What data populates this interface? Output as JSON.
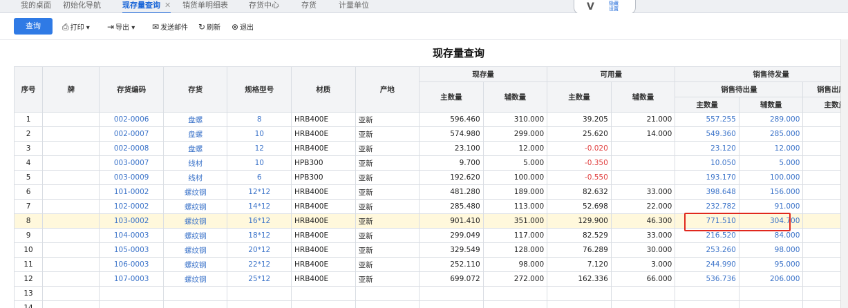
{
  "tabs": [
    {
      "label": "我的桌面",
      "active": false
    },
    {
      "label": "初始化导航",
      "active": false
    },
    {
      "label": "现存量查询",
      "active": true,
      "close": "✕"
    },
    {
      "label": "销货单明细表",
      "active": false
    },
    {
      "label": "存货中心",
      "active": false
    },
    {
      "label": "存货",
      "active": false
    },
    {
      "label": "计量单位",
      "active": false
    }
  ],
  "logo": {
    "mark": "V",
    "text": "隐藏设置"
  },
  "toolbar": {
    "query": "查询",
    "print": "打印",
    "export": "导出",
    "email": "发送邮件",
    "refresh": "刷新",
    "exit": "退出"
  },
  "page_title": "现存量查询",
  "table": {
    "headers": {
      "seq": "序号",
      "brand": "牌",
      "code": "存货编码",
      "item": "存货",
      "spec": "规格型号",
      "material": "材质",
      "origin": "产地",
      "onhand": "现存量",
      "available": "可用量",
      "sales_pending": "销售待发量",
      "sales_out_pending": "销售待出量",
      "sales_out_entry": "销售出库单",
      "main_qty": "主数量",
      "aux_qty": "辅数量"
    },
    "rows": [
      {
        "seq": "1",
        "code": "002-0006",
        "item": "盘螺",
        "spec": "8",
        "material": "HRB400E",
        "origin": "亚新",
        "oh_main": "596.460",
        "oh_aux": "310.000",
        "av_main": "39.205",
        "av_aux": "21.000",
        "so_main": "557.255",
        "so_aux": "289.000",
        "se_main": ""
      },
      {
        "seq": "2",
        "code": "002-0007",
        "item": "盘螺",
        "spec": "10",
        "material": "HRB400E",
        "origin": "亚新",
        "oh_main": "574.980",
        "oh_aux": "299.000",
        "av_main": "25.620",
        "av_aux": "14.000",
        "so_main": "549.360",
        "so_aux": "285.000",
        "se_main": ""
      },
      {
        "seq": "3",
        "code": "002-0008",
        "item": "盘螺",
        "spec": "12",
        "material": "HRB400E",
        "origin": "亚新",
        "oh_main": "23.100",
        "oh_aux": "12.000",
        "av_main": "-0.020",
        "av_aux": "",
        "so_main": "23.120",
        "so_aux": "12.000",
        "se_main": ""
      },
      {
        "seq": "4",
        "code": "003-0007",
        "item": "线材",
        "spec": "10",
        "material": "HPB300",
        "origin": "亚新",
        "oh_main": "9.700",
        "oh_aux": "5.000",
        "av_main": "-0.350",
        "av_aux": "",
        "so_main": "10.050",
        "so_aux": "5.000",
        "se_main": ""
      },
      {
        "seq": "5",
        "code": "003-0009",
        "item": "线材",
        "spec": "6",
        "material": "HPB300",
        "origin": "亚新",
        "oh_main": "192.620",
        "oh_aux": "100.000",
        "av_main": "-0.550",
        "av_aux": "",
        "so_main": "193.170",
        "so_aux": "100.000",
        "se_main": ""
      },
      {
        "seq": "6",
        "code": "101-0002",
        "item": "螺纹钢",
        "spec": "12*12",
        "material": "HRB400E",
        "origin": "亚新",
        "oh_main": "481.280",
        "oh_aux": "189.000",
        "av_main": "82.632",
        "av_aux": "33.000",
        "so_main": "398.648",
        "so_aux": "156.000",
        "se_main": ""
      },
      {
        "seq": "7",
        "code": "102-0002",
        "item": "螺纹钢",
        "spec": "14*12",
        "material": "HRB400E",
        "origin": "亚新",
        "oh_main": "285.480",
        "oh_aux": "113.000",
        "av_main": "52.698",
        "av_aux": "22.000",
        "so_main": "232.782",
        "so_aux": "91.000",
        "se_main": ""
      },
      {
        "seq": "8",
        "code": "103-0002",
        "item": "螺纹钢",
        "spec": "16*12",
        "material": "HRB400E",
        "origin": "亚新",
        "oh_main": "901.410",
        "oh_aux": "351.000",
        "av_main": "129.900",
        "av_aux": "46.300",
        "so_main": "771.510",
        "so_aux": "304.700",
        "se_main": ""
      },
      {
        "seq": "9",
        "code": "104-0003",
        "item": "螺纹钢",
        "spec": "18*12",
        "material": "HRB400E",
        "origin": "亚新",
        "oh_main": "299.049",
        "oh_aux": "117.000",
        "av_main": "82.529",
        "av_aux": "33.000",
        "so_main": "216.520",
        "so_aux": "84.000",
        "se_main": ""
      },
      {
        "seq": "10",
        "code": "105-0003",
        "item": "螺纹钢",
        "spec": "20*12",
        "material": "HRB400E",
        "origin": "亚新",
        "oh_main": "329.549",
        "oh_aux": "128.000",
        "av_main": "76.289",
        "av_aux": "30.000",
        "so_main": "253.260",
        "so_aux": "98.000",
        "se_main": ""
      },
      {
        "seq": "11",
        "code": "106-0003",
        "item": "螺纹钢",
        "spec": "22*12",
        "material": "HRB400E",
        "origin": "亚新",
        "oh_main": "252.110",
        "oh_aux": "98.000",
        "av_main": "7.120",
        "av_aux": "3.000",
        "so_main": "244.990",
        "so_aux": "95.000",
        "se_main": ""
      },
      {
        "seq": "12",
        "code": "107-0003",
        "item": "螺纹钢",
        "spec": "25*12",
        "material": "HRB400E",
        "origin": "亚新",
        "oh_main": "699.072",
        "oh_aux": "272.000",
        "av_main": "162.336",
        "av_aux": "66.000",
        "so_main": "536.736",
        "so_aux": "206.000",
        "se_main": ""
      },
      {
        "seq": "13",
        "code": "",
        "item": "",
        "spec": "",
        "material": "",
        "origin": "",
        "oh_main": "",
        "oh_aux": "",
        "av_main": "",
        "av_aux": "",
        "so_main": "",
        "so_aux": "",
        "se_main": ""
      },
      {
        "seq": "14",
        "code": "",
        "item": "",
        "spec": "",
        "material": "",
        "origin": "",
        "oh_main": "",
        "oh_aux": "",
        "av_main": "",
        "av_aux": "",
        "so_main": "",
        "so_aux": "",
        "se_main": ""
      }
    ],
    "highlighted_row": 8
  },
  "colors": {
    "accent": "#2f7ae5",
    "link": "#3b73c9",
    "negative": "#e03c3c",
    "highlight_row": "#fff8dc",
    "annotation_box": "#e0281e"
  }
}
